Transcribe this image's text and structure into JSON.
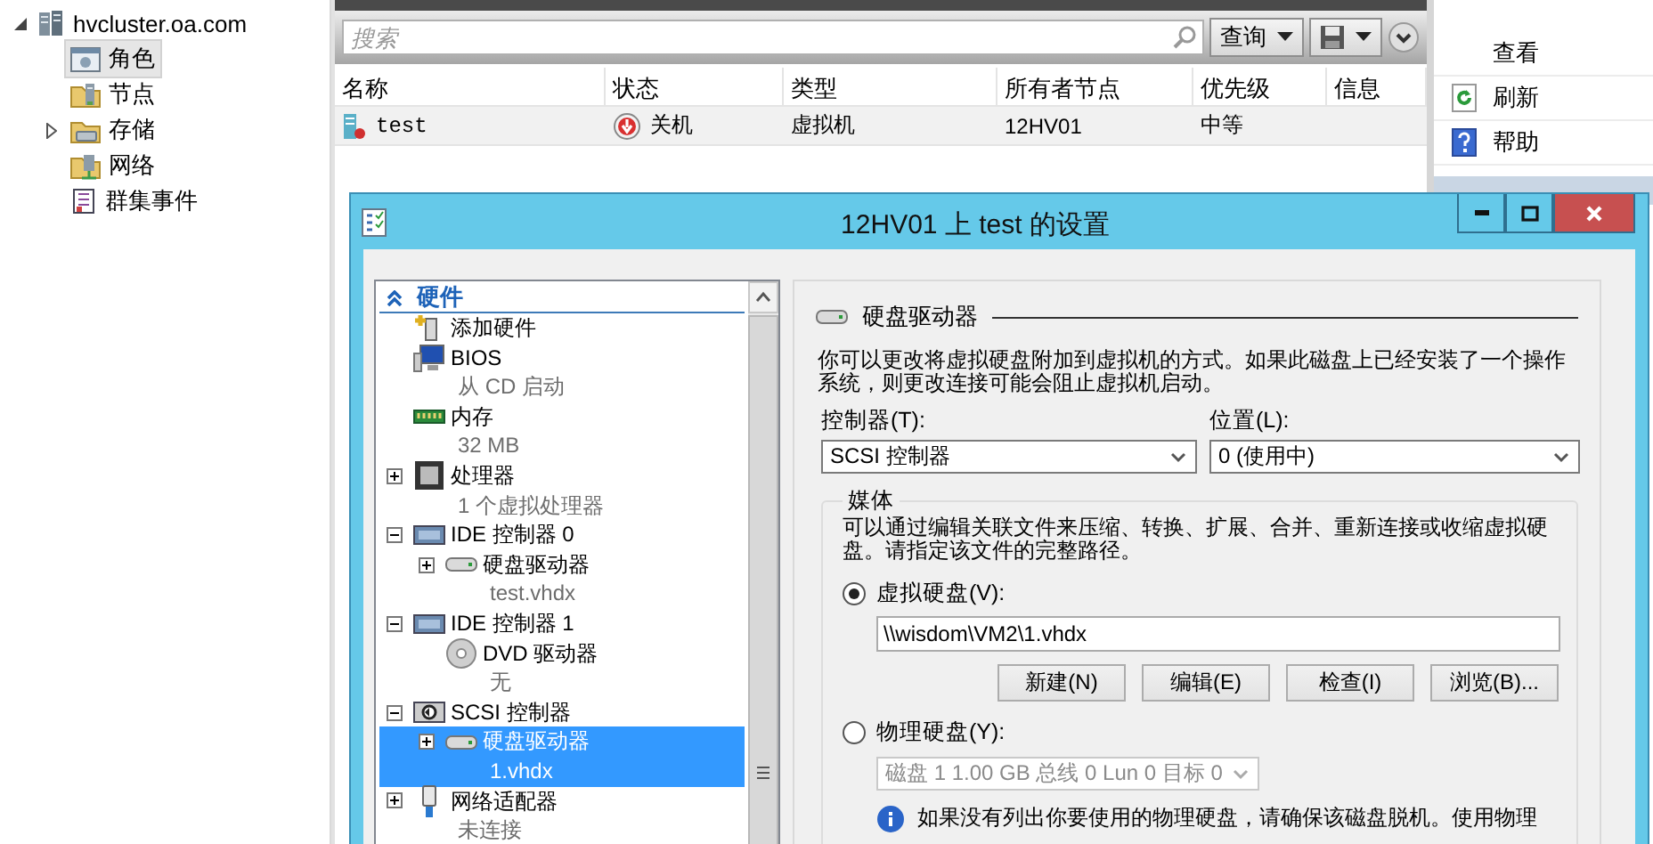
{
  "nav_tree": [
    {
      "label": "hvcluster.oa.com",
      "expanded": true,
      "selected": false,
      "children": [
        {
          "label": "角色",
          "selected": true
        },
        {
          "label": "节点",
          "selected": false
        },
        {
          "label": "存储",
          "expanded": false,
          "selected": false
        },
        {
          "label": "网络",
          "selected": false
        },
        {
          "label": "群集事件",
          "selected": false
        }
      ]
    }
  ],
  "results": {
    "search": {
      "placeholder": "搜索"
    },
    "query_button": {
      "label": "查询"
    },
    "table": {
      "columns": [
        "名称",
        "状态",
        "类型",
        "所有者节点",
        "优先级",
        "信息"
      ],
      "rows": [
        {
          "cells": [
            "test",
            "关机",
            "虚拟机",
            "12HV01",
            "中等"
          ]
        }
      ]
    }
  },
  "actions": [
    {
      "label": "查看"
    },
    {
      "label": "刷新"
    },
    {
      "label": "帮助"
    }
  ],
  "dialog": {
    "title": "12HV01 上 test 的设置",
    "hardware": {
      "title": "硬件",
      "expanded": true,
      "items": [
        {
          "label": "添加硬件",
          "kind": "add",
          "selected": false
        },
        {
          "label": "BIOS",
          "detail": "从 CD 启动",
          "kind": "bios",
          "selected": false
        },
        {
          "label": "内存",
          "detail": "32 MB",
          "kind": "memory",
          "selected": false
        },
        {
          "label": "处理器",
          "detail": "1 个虚拟处理器",
          "kind": "cpu",
          "expanded": false,
          "selected": false
        },
        {
          "label": "IDE 控制器 0",
          "kind": "controller",
          "expanded": true,
          "selected": false,
          "children": [
            {
              "label": "硬盘驱动器",
              "detail": "test.vhdx",
              "kind": "disk",
              "expanded": false,
              "selected": false
            }
          ]
        },
        {
          "label": "IDE 控制器 1",
          "kind": "controller",
          "expanded": true,
          "selected": false,
          "children": [
            {
              "label": "DVD 驱动器",
              "detail": "无",
              "kind": "dvd",
              "selected": false
            }
          ]
        },
        {
          "label": "SCSI 控制器",
          "kind": "scsi",
          "expanded": true,
          "selected": false,
          "children": [
            {
              "label": "硬盘驱动器",
              "detail": "1.vhdx",
              "kind": "disk",
              "expanded": false,
              "selected": true
            }
          ]
        },
        {
          "label": "网络适配器",
          "detail": "未连接",
          "kind": "network",
          "expanded": false,
          "selected": false
        }
      ]
    },
    "pane": {
      "title": "硬盘驱动器",
      "description": "你可以更改将虚拟硬盘附加到虚拟机的方式。如果此磁盘上已经安装了一个操作系统，则更改连接可能会阻止虚拟机启动。",
      "fields": [
        {
          "label": "控制器(T):",
          "value": "SCSI 控制器"
        },
        {
          "label": "位置(L):",
          "value": "0 (使用中)"
        }
      ],
      "media": {
        "title": "媒体",
        "description": "可以通过编辑关联文件来压缩、转换、扩展、合并、重新连接或收缩虚拟硬盘。请指定该文件的完整路径。",
        "options": [
          {
            "kind": "file",
            "label": "虚拟硬盘(V):",
            "selected": true,
            "path": "\\\\wisdom\\VM2\\1.vhdx",
            "buttons": [
              "新建(N)",
              "编辑(E)",
              "检查(I)",
              "浏览(B)..."
            ]
          },
          {
            "kind": "physical",
            "label": "物理硬盘(Y):",
            "selected": false,
            "disk": {
              "value": "磁盘 1 1.00 GB 总线 0 Lun 0 目标 0",
              "disabled": true
            },
            "note": "如果没有列出你要使用的物理硬盘，请确保该磁盘脱机。使用物理"
          }
        ]
      }
    }
  }
}
